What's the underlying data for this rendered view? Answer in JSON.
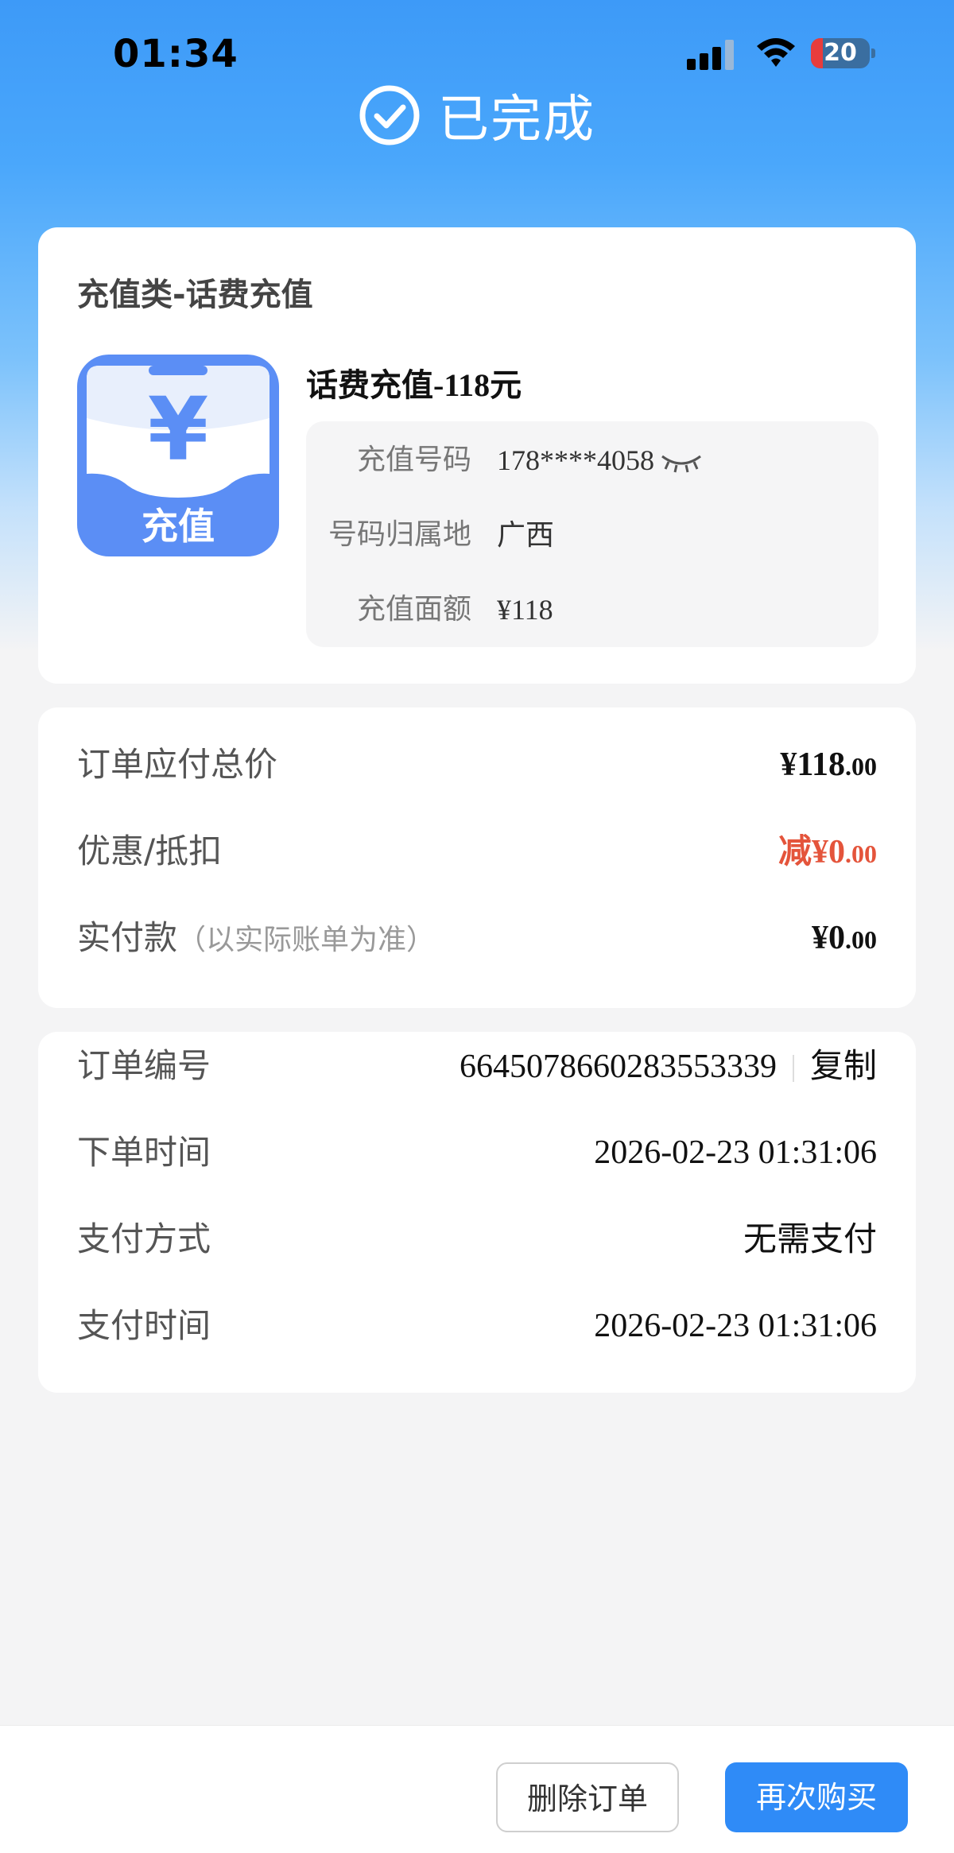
{
  "status_bar": {
    "time": "01:34",
    "battery": "20",
    "battery_level": 0.2
  },
  "header": {
    "title": "已完成",
    "icon": "check-circle-icon"
  },
  "product": {
    "category": "充值类-话费充值",
    "icon_text": "充值",
    "icon_symbol": "¥",
    "name": "话费充值-118元",
    "details": [
      {
        "label": "充值号码",
        "value": "178****4058"
      },
      {
        "label": "号码归属地",
        "value": "广西"
      },
      {
        "label": "充值面额",
        "value": "¥118"
      }
    ]
  },
  "price": {
    "total_label": "订单应付总价",
    "total_int": "¥118",
    "total_cents": ".00",
    "discount_label": "优惠/抵扣",
    "discount_prefix": "减",
    "discount_int": "¥0",
    "discount_cents": ".00",
    "paid_label": "实付款",
    "paid_note": "（以实际账单为准）",
    "paid_int": "¥0",
    "paid_cents": ".00"
  },
  "order": {
    "number_label": "订单编号",
    "number": "6645078660283553339",
    "copy_label": "复制",
    "order_time_label": "下单时间",
    "order_time": "2026-02-23 01:31:06",
    "pay_method_label": "支付方式",
    "pay_method": "无需支付",
    "pay_time_label": "支付时间",
    "pay_time": "2026-02-23 01:31:06"
  },
  "actions": {
    "delete_label": "删除订单",
    "rebuy_label": "再次购买"
  },
  "colors": {
    "primary": "#2f8bf7",
    "discount": "#e4543b",
    "icon_blue": "#5b8ef5"
  }
}
